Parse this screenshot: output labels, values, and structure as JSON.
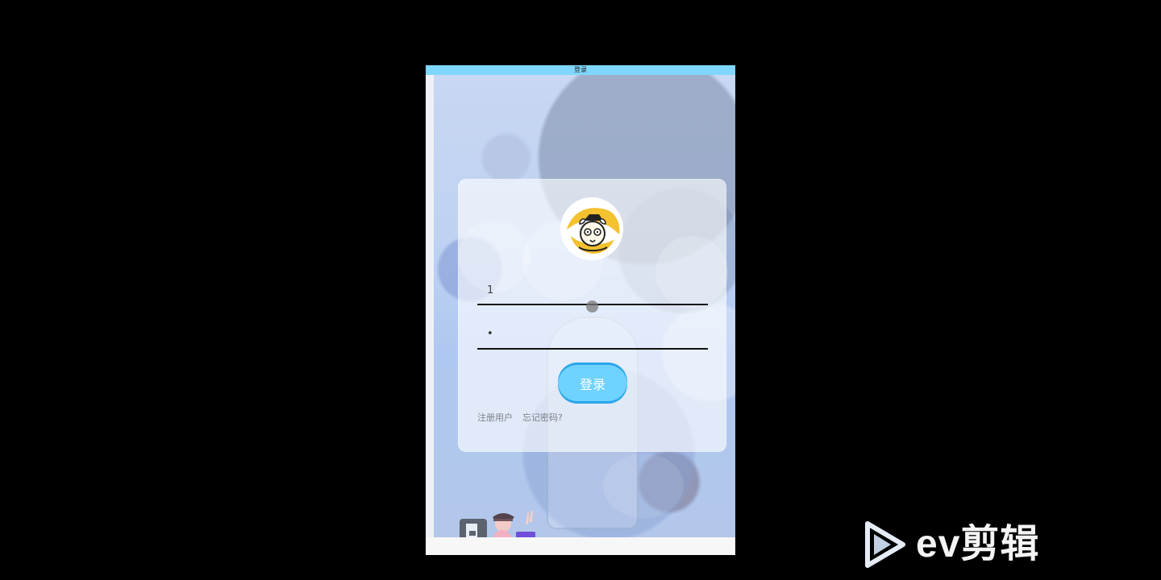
{
  "window": {
    "title": "登录"
  },
  "login": {
    "username_value": "1",
    "password_mask": "•",
    "button_label": "登录",
    "register_link": "注册用户",
    "forgot_link": "忘记密码?"
  },
  "watermark": {
    "text": "ev剪辑"
  },
  "colors": {
    "accent": "#6fd2ff",
    "titlebar": "#7fd7ff",
    "background": "#000000"
  },
  "icons": {
    "avatar": "cartoon-avatar-icon",
    "character": "cartoon-character-icon",
    "watermark_logo": "ev-play-logo-icon"
  }
}
